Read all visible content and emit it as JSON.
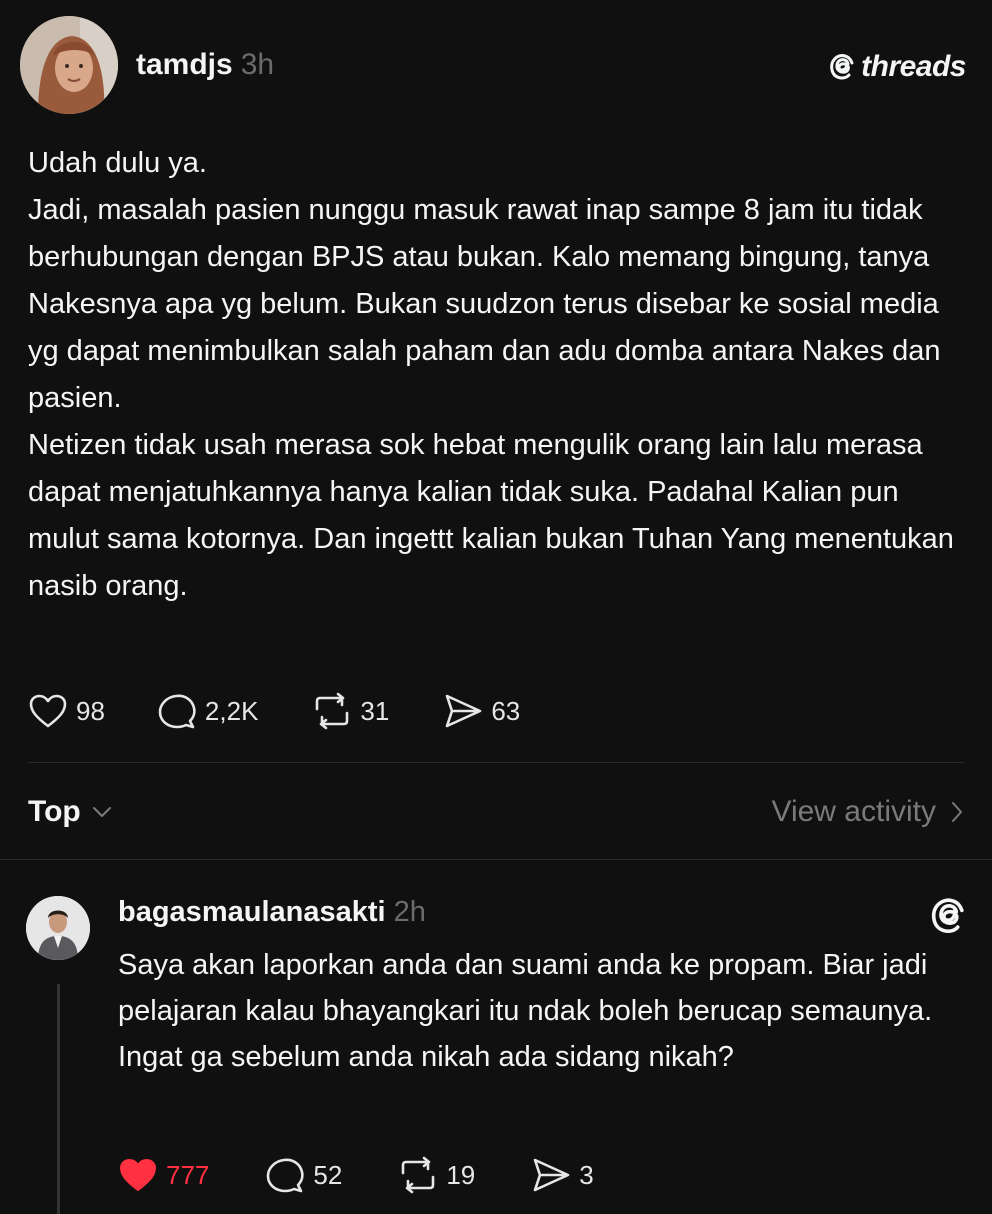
{
  "post": {
    "username": "tamdjs",
    "timestamp": "3h",
    "brand": "threads",
    "paragraphs": [
      "Udah dulu ya.",
      "Jadi, masalah pasien nunggu masuk rawat inap sampe 8 jam itu tidak berhubungan dengan BPJS atau bukan. Kalo memang bingung, tanya Nakesnya apa yg belum. Bukan suudzon terus disebar ke sosial media yg dapat menimbulkan salah paham dan adu domba antara Nakes dan pasien.",
      "Netizen tidak usah merasa sok hebat mengulik orang lain lalu merasa dapat menjatuhkannya hanya kalian tidak suka. Padahal Kalian pun mulut sama kotornya. Dan ingettt kalian bukan Tuhan Yang menentukan nasib orang."
    ],
    "likes": "98",
    "replies": "2,2K",
    "reposts": "31",
    "shares": "63"
  },
  "sort": {
    "label": "Top",
    "view_activity": "View activity"
  },
  "reply": {
    "username": "bagasmaulanasakti",
    "timestamp": "2h",
    "text": "Saya akan laporkan anda dan suami anda ke propam. Biar jadi pelajaran kalau bhayangkari itu ndak boleh berucap semaunya. Ingat ga sebelum anda nikah ada sidang nikah?",
    "likes": "777",
    "replies": "52",
    "reposts": "19",
    "shares": "3",
    "liked": true
  },
  "colors": {
    "background": "#101010",
    "text": "#f3f5f7",
    "muted": "#6b6b6b",
    "like_active": "#ff3040"
  }
}
